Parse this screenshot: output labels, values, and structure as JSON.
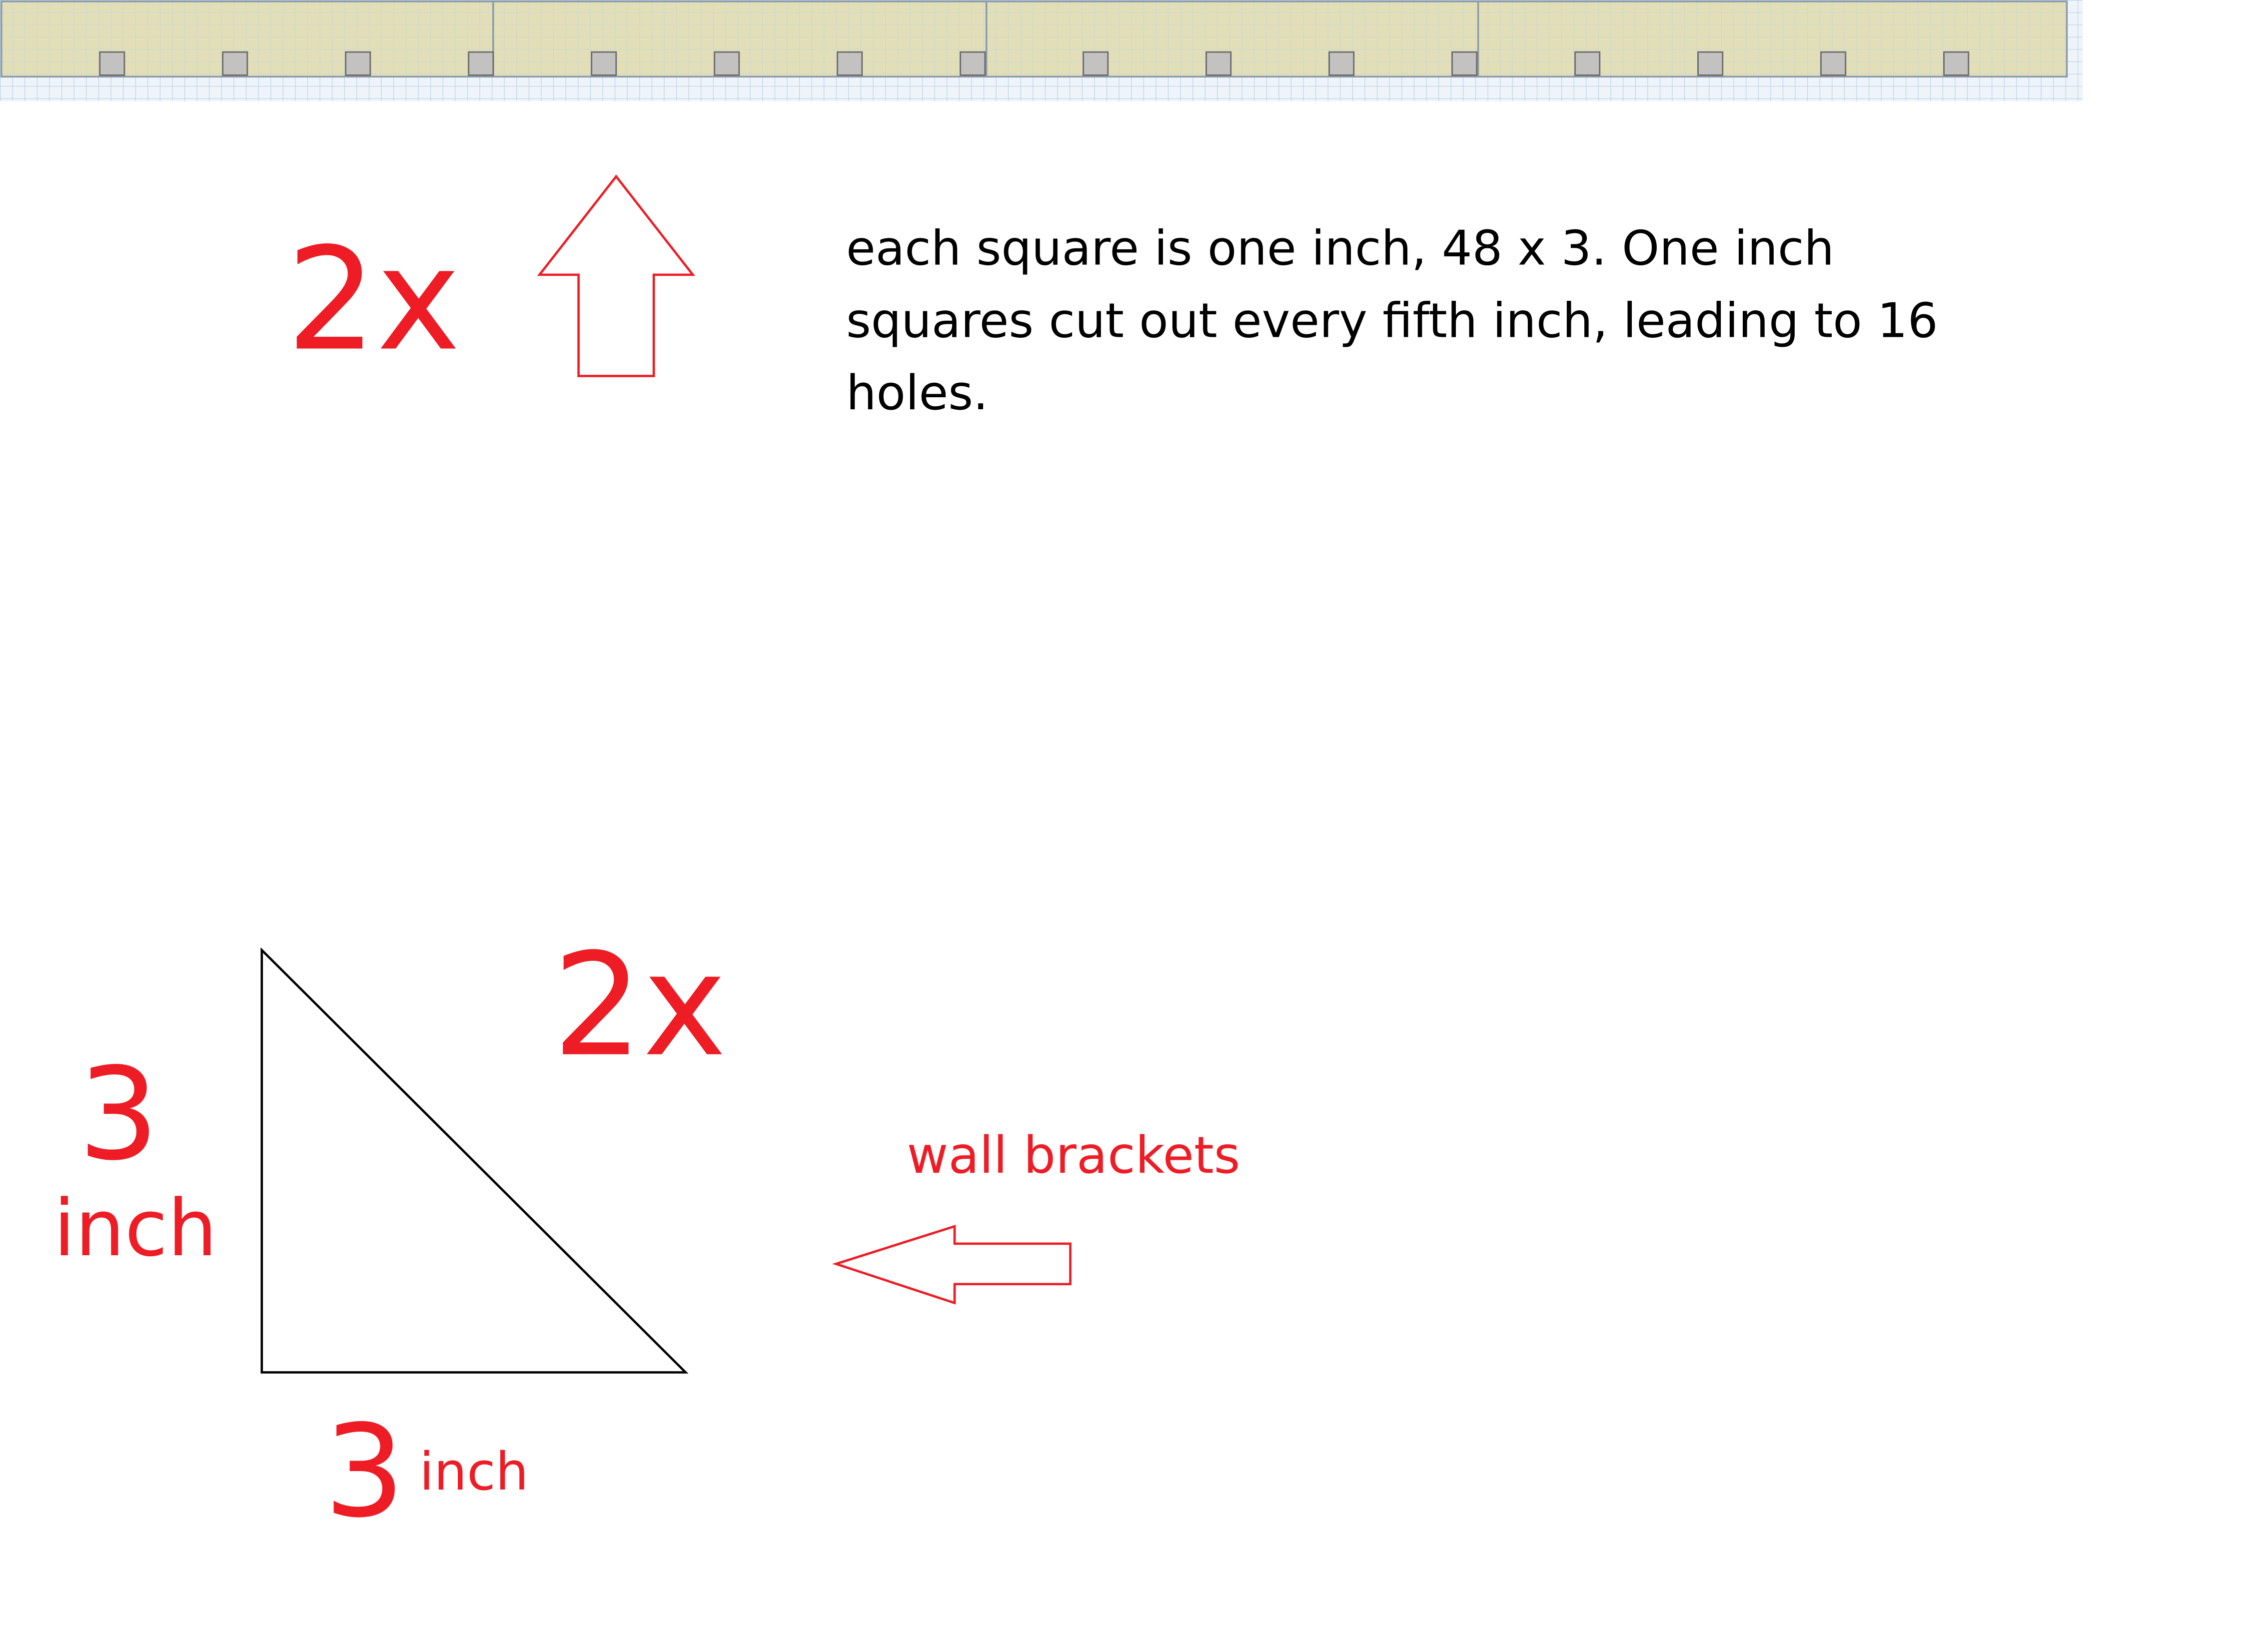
{
  "board": {
    "hole_count": 16,
    "board_color": "#e2dfb8",
    "grid_color": "#b8d2e4",
    "hole_color": "#c4c2c0"
  },
  "shelf_group": {
    "multiplier": "2x",
    "description": "each square is one inch, 48 x 3. One inch squares cut out every fifth inch, leading to 16 holes."
  },
  "bracket_group": {
    "multiplier": "2x",
    "side_height_value": "3",
    "side_height_unit": "inch",
    "side_base_value": "3",
    "side_base_unit": "inch",
    "label": "wall brackets"
  },
  "colors": {
    "annotation": "#ee1c25",
    "outline": "#000000"
  }
}
